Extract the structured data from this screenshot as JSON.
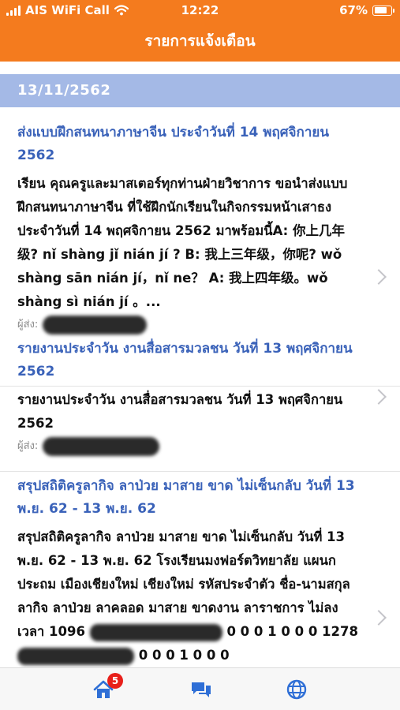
{
  "status_bar": {
    "carrier": "AIS WiFi Call",
    "time": "12:22",
    "battery_percent": "67%",
    "battery_level": 0.67
  },
  "header": {
    "title": "รายการแจ้งเตือน"
  },
  "date_group": "13/11/2562",
  "notifications": [
    {
      "title": "ส่งแบบฝึกสนทนาภาษาจีน ประจำวันที่ 14 พฤศจิกายน 2562",
      "body": "เรียน คุณครูและมาสเตอร์ทุกท่านฝ่ายวิชาการ ขอนำส่งแบบฝึกสนทนาภาษาจีน ที่ใช้ฝึกนักเรียนในกิจกรรมหน้าเสาธง ประจำวันที่ 14 พฤศจิกายน 2562 มาพร้อมนี้A: 你上几年级? nǐ shàng jǐ nián jí ? B: 我上三年级，你呢? wǒ shàng sān nián jí，nǐ ne？ A: 我上四年级。wǒ shàng sì nián jí 。...",
      "sender_label": "ผู้ส่ง:"
    },
    {
      "title": "รายงานประจำวัน งานสื่อสารมวลชน วันที่ 13 พฤศจิกายน 2562",
      "body": "รายงานประจำวัน งานสื่อสารมวลชน วันที่ 13 พฤศจิกายน 2562",
      "sender_label": "ผู้ส่ง:"
    },
    {
      "title": "สรุปสถิติครูลากิจ ลาป่วย มาสาย ขาด ไม่เซ็นกลับ วันที่ 13 พ.ย. 62 - 13 พ.ย. 62",
      "body_main": "สรุปสถิติครูลากิจ ลาป่วย มาสาย ขาด ไม่เซ็นกลับ วันที่ 13 พ.ย. 62 - 13 พ.ย. 62 โรงเรียนมงฟอร์ตวิทยาลัย แผนกประถม เมืองเชียงใหม่ เชียงใหม่ รหัสประจำตัว ชื่อ-นามสกุล ลากิจ ลาป่วย ลาคลอด มาสาย ขาดงาน ลาราชการ ไม่ลงเวลา 1096",
      "body_line_a_end": "0 0",
      "body_line_b_start": "0 1 0 0 0 1278",
      "body_line_b_end": "0 0 0 1 0 0 0"
    }
  ],
  "tab_bar": {
    "home_badge": "5",
    "tabs": [
      "home-icon",
      "chat-icon",
      "globe-icon"
    ]
  },
  "colors": {
    "primary": "#f47b1e",
    "date_header": "#a4b9e6",
    "title_text": "#3a62b9",
    "badge": "#e8201b"
  }
}
